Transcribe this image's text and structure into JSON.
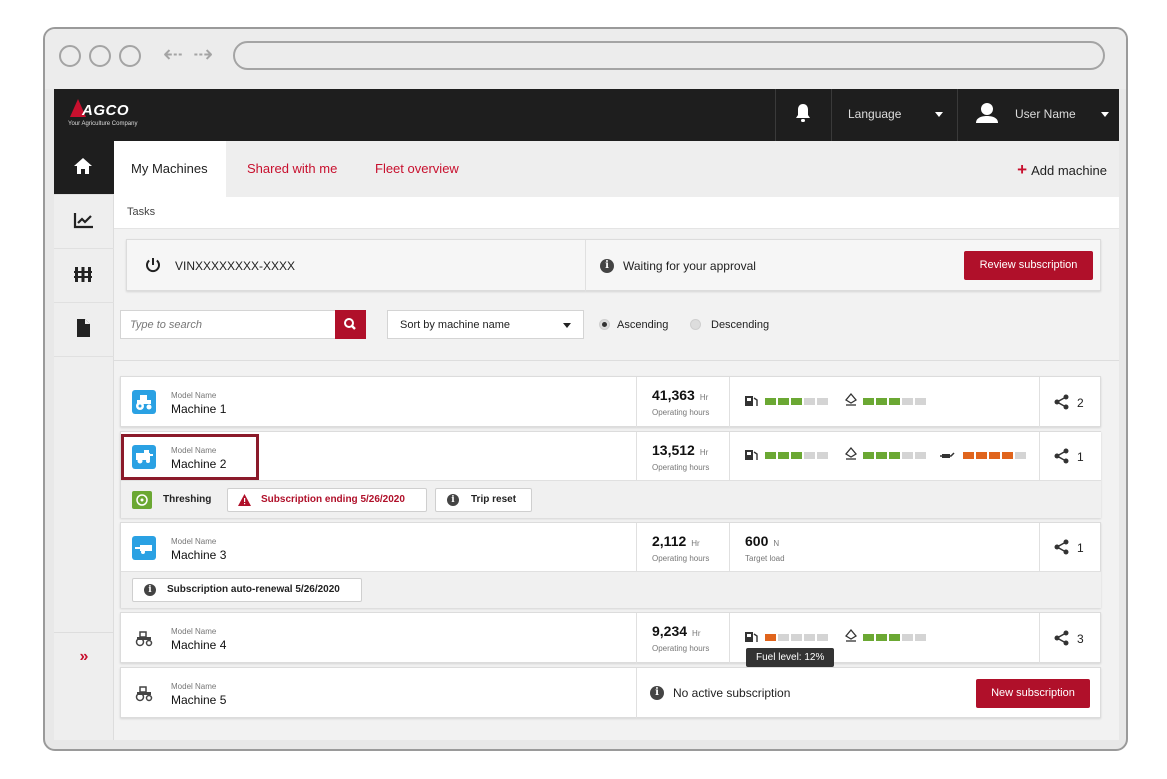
{
  "app": {
    "logo_text": "AGCO",
    "logo_tagline": "Your Agriculture Company",
    "language_label": "Language",
    "user_name": "User Name"
  },
  "tabs": [
    {
      "label": "My Machines",
      "active": true
    },
    {
      "label": "Shared with me",
      "active": false
    },
    {
      "label": "Fleet overview",
      "active": false
    }
  ],
  "add_machine_label": "Add machine",
  "tasks": {
    "header": "Tasks",
    "vin": "VINXXXXXXXX-XXXX",
    "status": "Waiting for your approval",
    "action_label": "Review subscription"
  },
  "filters": {
    "search_placeholder": "Type to search",
    "sort_label": "Sort by machine name",
    "ascending_label": "Ascending",
    "descending_label": "Descending",
    "selected_order": "ascending"
  },
  "machines": [
    {
      "model": "Model Name",
      "name": "Machine 1",
      "hours": "41,363",
      "hours_unit": "Hr",
      "hours_label": "Operating hours",
      "fuel_level": 3,
      "def_level": 3,
      "shares": "2"
    },
    {
      "model": "Model Name",
      "name": "Machine 2",
      "hours": "13,512",
      "hours_unit": "Hr",
      "hours_label": "Operating hours",
      "fuel_level": 3,
      "def_level": 3,
      "third_level": 4,
      "shares": "1",
      "chips": {
        "mode": "Threshing",
        "warning": "Subscription ending 5/26/2020",
        "trip": "Trip reset"
      }
    },
    {
      "model": "Model Name",
      "name": "Machine 3",
      "hours": "2,112",
      "hours_unit": "Hr",
      "hours_label": "Operating hours",
      "load": "600",
      "load_unit": "N",
      "load_label": "Target load",
      "shares": "1",
      "chips": {
        "info": "Subscription auto-renewal 5/26/2020"
      }
    },
    {
      "model": "Model Name",
      "name": "Machine 4",
      "hours": "9,234",
      "hours_unit": "Hr",
      "hours_label": "Operating hours",
      "fuel_level": 1,
      "def_level": 3,
      "shares": "3",
      "tooltip": "Fuel level: 12%"
    },
    {
      "model": "Model Name",
      "name": "Machine 5",
      "status": "No active subscription",
      "action_label": "New subscription"
    }
  ],
  "colors": {
    "brand": "#b0102a",
    "good": "#6ba833",
    "warn": "#e0641c",
    "icon_blue": "#2aa1e3"
  }
}
